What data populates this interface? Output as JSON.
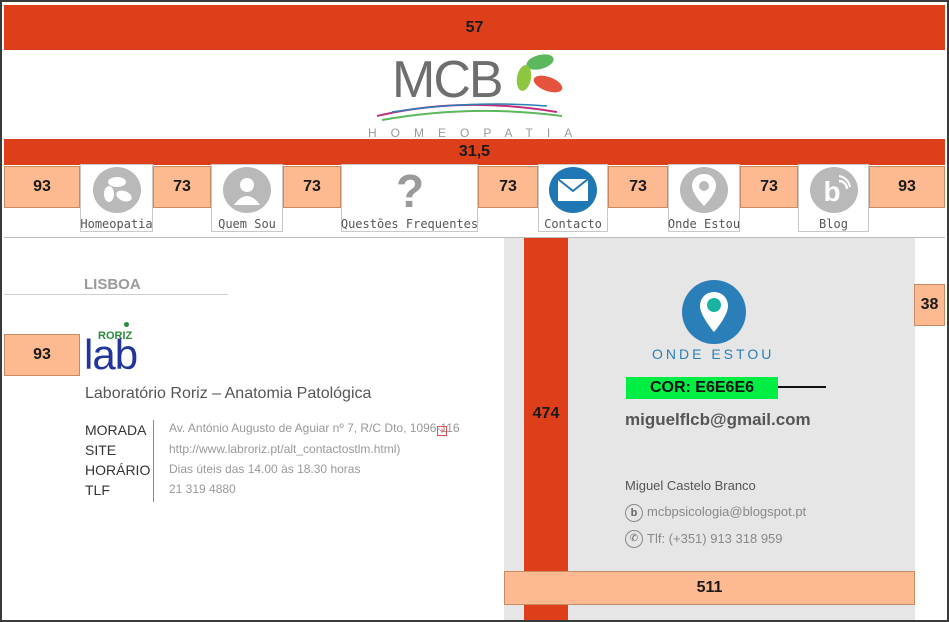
{
  "measurements": {
    "top_band": "57",
    "nav_band": "31,5",
    "nav_left": "93",
    "gap1": "73",
    "gap2": "73",
    "gap3": "73",
    "gap4": "73",
    "gap5": "73",
    "nav_right": "93",
    "content_left": "93",
    "vertical": "474",
    "right_marker": "38",
    "bottom": "511"
  },
  "logo": {
    "letters": "MCB",
    "subtitle": "HOMEOPATIA"
  },
  "nav": {
    "items": [
      {
        "label": "Homeopatia",
        "icon": "leaves-icon"
      },
      {
        "label": "Quem Sou",
        "icon": "person-icon"
      },
      {
        "label": "Questões Frequentes",
        "icon": "question-icon"
      },
      {
        "label": "Contacto",
        "icon": "envelope-icon"
      },
      {
        "label": "Onde Estou",
        "icon": "location-pin-icon"
      },
      {
        "label": "Blog",
        "icon": "blog-icon"
      }
    ]
  },
  "location": {
    "city": "LISBOA",
    "lab_brand_top": "RORIZ",
    "lab_brand": "lab",
    "lab_name": "Laboratório Roriz – Anatomia Patológica",
    "rows": [
      {
        "label": "MORADA",
        "value": "Av. António Augusto de Aguiar nº 7, R/C Dto, 1096-116"
      },
      {
        "label": "SITE",
        "value": "http://www.labroriz.pt/alt_contactostlm.html)"
      },
      {
        "label": "HORÁRIO",
        "value": "Dias úteis das 14.00 às 18.30 horas"
      },
      {
        "label": "TLF",
        "value": "21 319 4880"
      }
    ]
  },
  "contact": {
    "heading": "ONDE ESTOU",
    "color_note": "COR: E6E6E6",
    "email": "miguelflcb@gmail.com",
    "name": "Miguel Castelo Branco",
    "blog": "mcbpsicologia@blogspot.pt",
    "phone": "Tlf: (+351) 913 318 959"
  },
  "colors": {
    "annotation": "#dc3f1a",
    "peach": "#fdb98f",
    "panel": "#e6e6e6",
    "brand_blue": "#2a7fb8",
    "note_green": "#00ee44"
  }
}
